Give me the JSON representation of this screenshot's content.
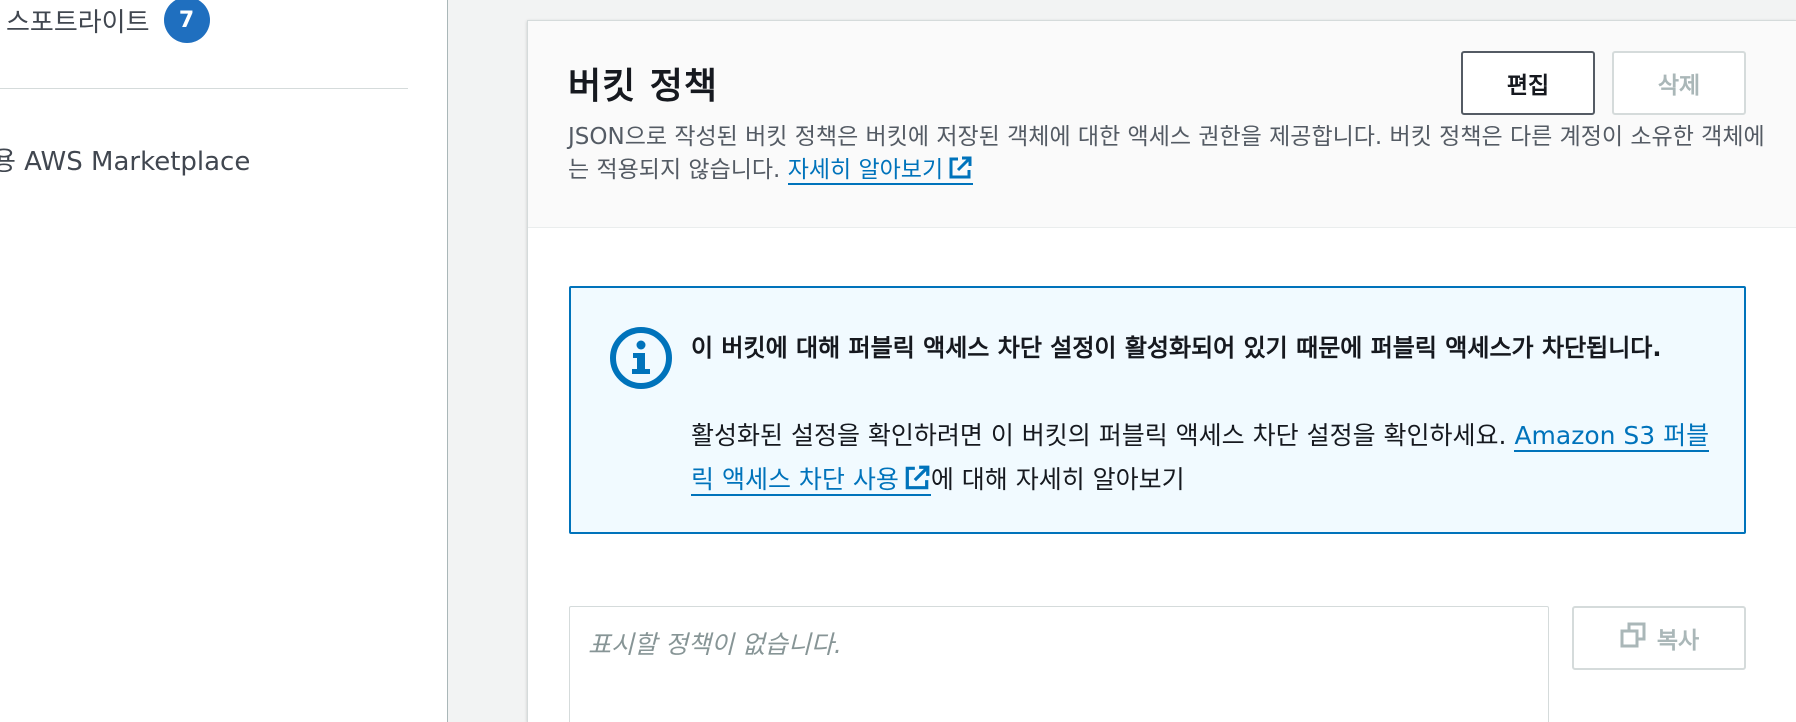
{
  "sidebar": {
    "spotlight_label": "스포트라이트",
    "spotlight_count": "7",
    "marketplace_label": "용 AWS Marketplace"
  },
  "bucket_policy": {
    "title": "버킷 정책",
    "description": "JSON으로 작성된 버킷 정책은 버킷에 저장된 객체에 대한 액세스 권한을 제공합니다. 버킷 정책은 다른 계정이 소유한 객체에는 적용되지 않습니다.",
    "learn_more_link": "자세히 알아보기",
    "edit_button": "편집",
    "delete_button": "삭제"
  },
  "alert": {
    "type": "info",
    "title": "이 버킷에 대해 퍼블릭 액세스 차단 설정이 활성화되어 있기 때문에 퍼블릭 액세스가 차단됩니다.",
    "body_prefix": "활성화된 설정을 확인하려면 이 버킷의 퍼블릭 액세스 차단 설정을 확인하세요.",
    "link_text": "Amazon S3 퍼블릭 액세스 차단 사용",
    "body_suffix": "에 대해 자세히 알아보기"
  },
  "policy_editor": {
    "placeholder": "표시할 정책이 없습니다.",
    "copy_button": "복사"
  },
  "colors": {
    "link": "#0073bb",
    "badge": "#1f6fbf",
    "alert_border": "#0073bb",
    "alert_bg": "#f1faff",
    "disabled": "#aab7b8"
  },
  "icons": [
    "external-link-icon",
    "info-icon",
    "copy-icon"
  ]
}
